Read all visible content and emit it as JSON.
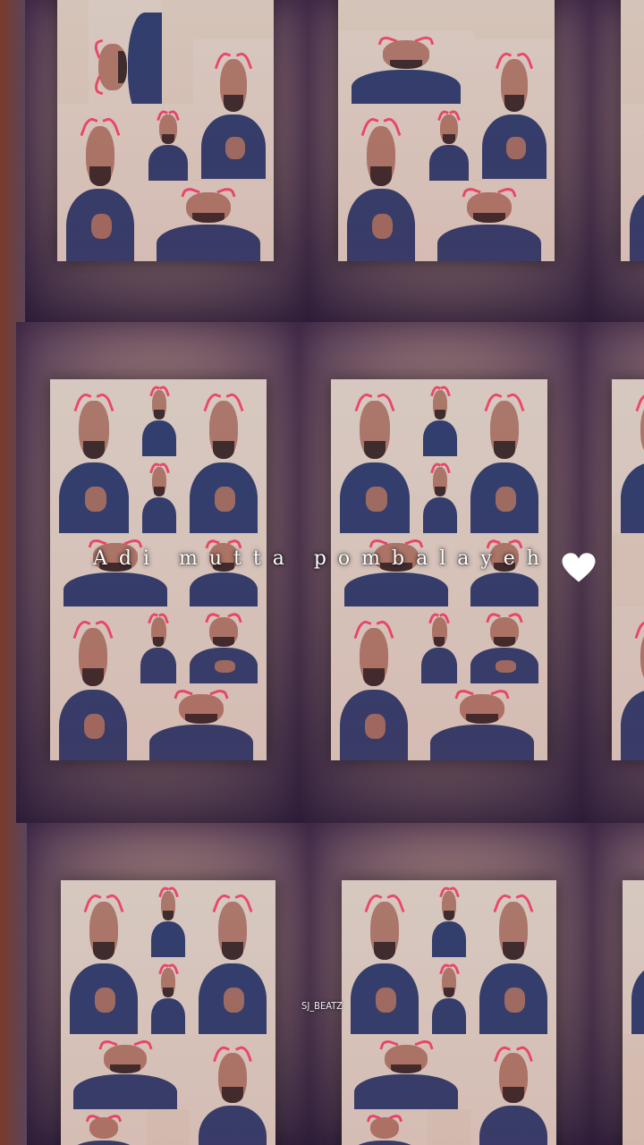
{
  "caption": {
    "text": "Adi mutta pombalayeh",
    "heart_icon": "heart-icon",
    "heart_color": "#ffffff"
  },
  "watermark": {
    "text": "SJ_BEATZ"
  },
  "colors": {
    "shirt": "#2c3f6e",
    "skin": "#b7806a",
    "horns": "#ff4a6a",
    "collage_bg": "#e7d7c3"
  }
}
